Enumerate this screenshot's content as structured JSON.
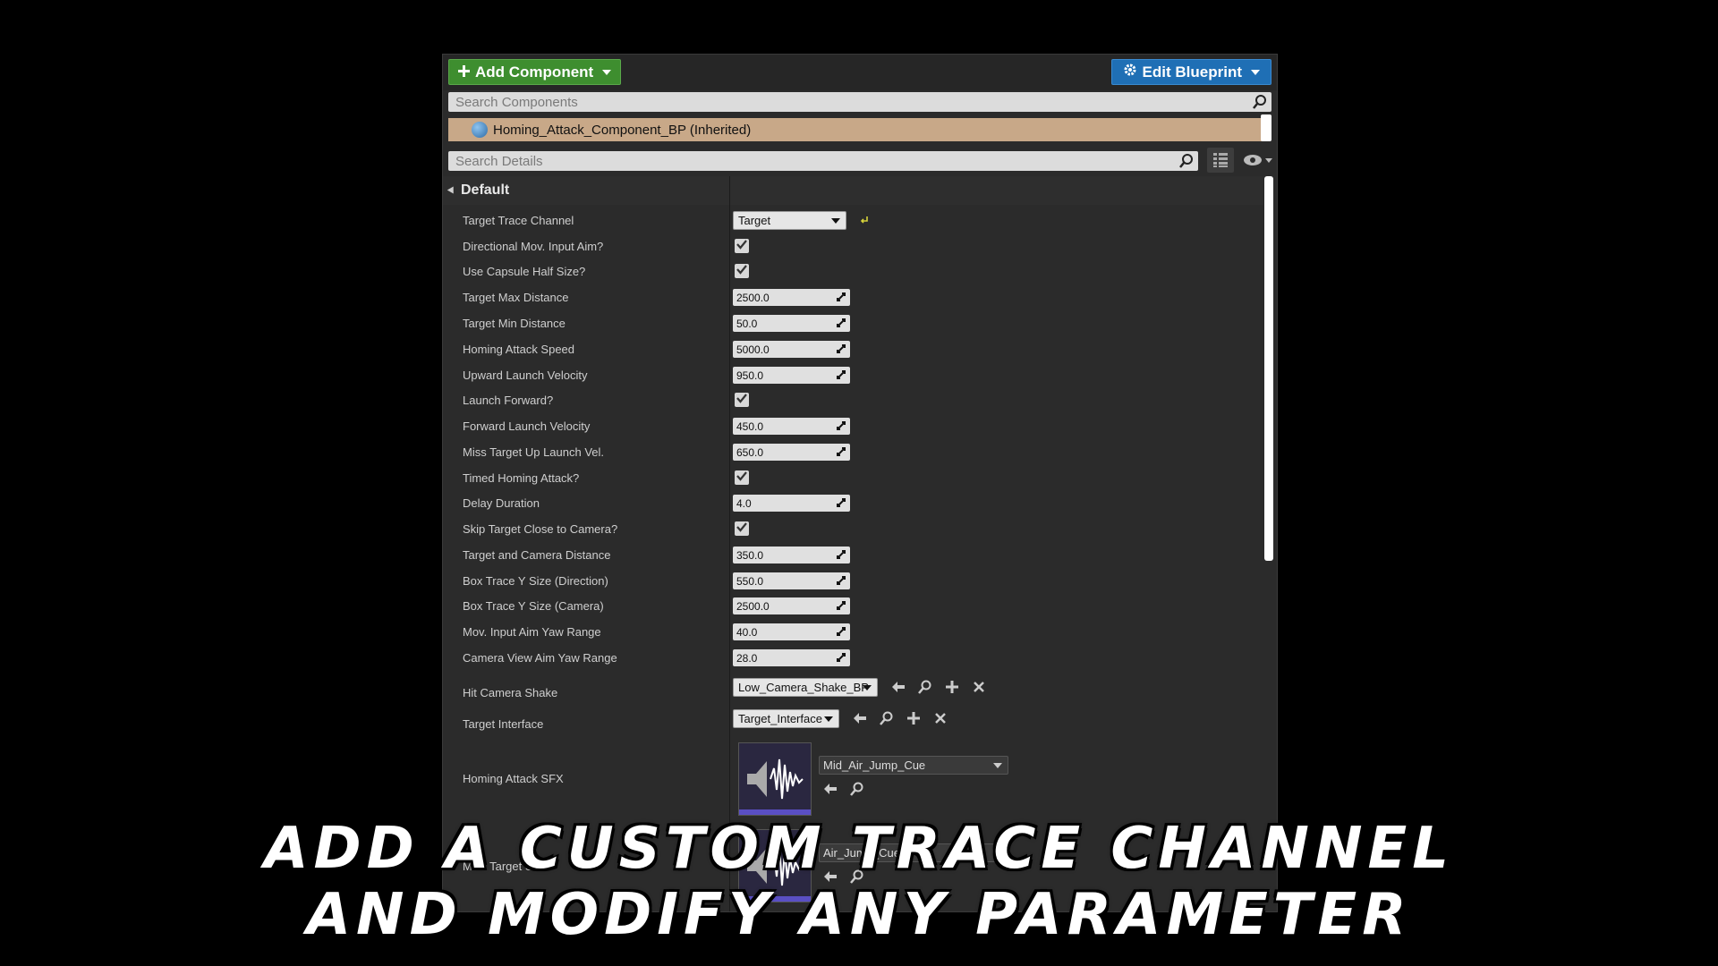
{
  "toolbar": {
    "add_component": "Add Component",
    "edit_blueprint": "Edit Blueprint"
  },
  "search_components": {
    "placeholder": "Search Components"
  },
  "component": {
    "label": "Homing_Attack_Component_BP (Inherited)"
  },
  "search_details": {
    "placeholder": "Search Details"
  },
  "section": {
    "title": "Default"
  },
  "props": [
    {
      "label": "Target Trace Channel",
      "type": "dropdown",
      "value": "Target"
    },
    {
      "label": "Directional Mov. Input Aim?",
      "type": "check"
    },
    {
      "label": "Use Capsule Half Size?",
      "type": "check"
    },
    {
      "label": "Target Max Distance",
      "type": "num",
      "value": "2500.0"
    },
    {
      "label": "Target Min Distance",
      "type": "num",
      "value": "50.0"
    },
    {
      "label": "Homing Attack Speed",
      "type": "num",
      "value": "5000.0"
    },
    {
      "label": "Upward Launch Velocity",
      "type": "num",
      "value": "950.0"
    },
    {
      "label": "Launch Forward?",
      "type": "check"
    },
    {
      "label": "Forward Launch Velocity",
      "type": "num",
      "value": "450.0"
    },
    {
      "label": "Miss Target Up Launch Vel.",
      "type": "num",
      "value": "650.0"
    },
    {
      "label": "Timed Homing Attack?",
      "type": "check"
    },
    {
      "label": "Delay Duration",
      "type": "num",
      "value": "4.0"
    },
    {
      "label": "Skip Target Close to Camera?",
      "type": "check"
    },
    {
      "label": "Target and Camera Distance",
      "type": "num",
      "value": "350.0"
    },
    {
      "label": "Box Trace Y Size (Direction)",
      "type": "num",
      "value": "550.0"
    },
    {
      "label": "Box Trace Y Size (Camera)",
      "type": "num",
      "value": "2500.0"
    },
    {
      "label": "Mov. Input Aim Yaw Range",
      "type": "num",
      "value": "40.0"
    },
    {
      "label": "Camera View Aim Yaw Range",
      "type": "num",
      "value": "28.0"
    }
  ],
  "hit_camera_shake": {
    "label": "Hit Camera Shake",
    "value": "Low_Camera_Shake_BP"
  },
  "target_interface": {
    "label": "Target Interface",
    "value": "Target_Interface"
  },
  "homing_sfx": {
    "label": "Homing Attack SFX",
    "value": "Mid_Air_Jump_Cue"
  },
  "miss_sfx": {
    "label": "Miss Target SFX",
    "value": "Air_Jump_Cue"
  },
  "overlay": {
    "line1": "ADD A CUSTOM TRACE CHANNEL",
    "line2": "AND MODIFY ANY PARAMETER"
  },
  "icons": [
    "plus-icon",
    "gear-icon",
    "search-icon",
    "globe-icon",
    "grid-icon",
    "eye-icon",
    "checkmark-icon",
    "spin-arrows-icon",
    "reset-arrow-icon",
    "back-arrow-icon",
    "browse-icon",
    "add-icon",
    "clear-icon",
    "sound-wave-icon"
  ],
  "colors": {
    "add_button": "#3e8e2f",
    "edit_button": "#1f6fb5",
    "component_row": "#c8a888",
    "panel_bg": "#2b2b2b"
  }
}
